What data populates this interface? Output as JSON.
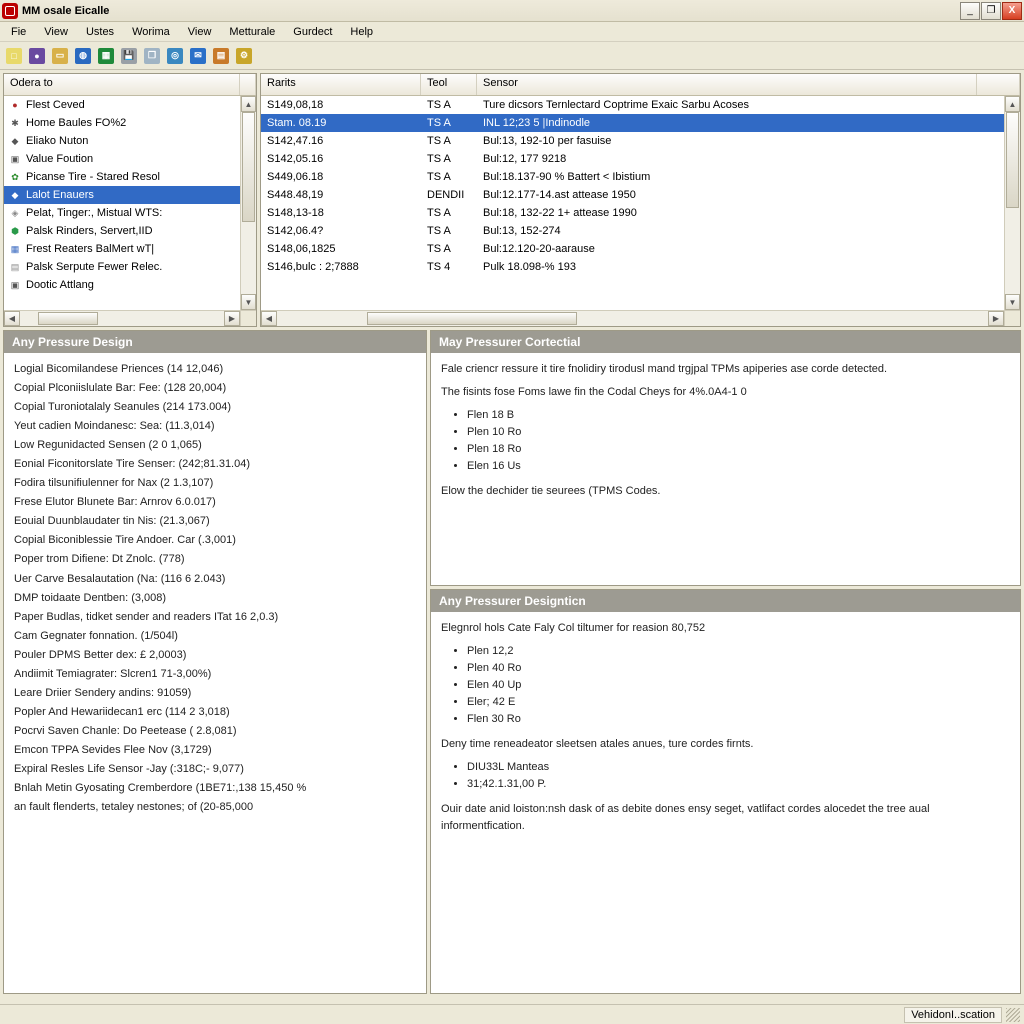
{
  "title": "MM osale Eicalle",
  "window_buttons": {
    "min": "_",
    "max": "❐",
    "close": "X"
  },
  "menu": [
    "Fie",
    "View",
    "Ustes",
    "Worima",
    "View",
    "Metturale",
    "Gurdect",
    "Help"
  ],
  "toolbar_icons": [
    {
      "name": "new-icon",
      "bg": "#e8d96a",
      "glyph": "□"
    },
    {
      "name": "globe-icon",
      "bg": "#6a4aa0",
      "glyph": "●"
    },
    {
      "name": "open-icon",
      "bg": "#d8b14a",
      "glyph": "▭"
    },
    {
      "name": "world-icon",
      "bg": "#2a6ac0",
      "glyph": "◍"
    },
    {
      "name": "sheet-icon",
      "bg": "#1f8a3a",
      "glyph": "▦"
    },
    {
      "name": "save-icon",
      "bg": "#9aa0a6",
      "glyph": "💾"
    },
    {
      "name": "copy-icon",
      "bg": "#a0b4c4",
      "glyph": "❐"
    },
    {
      "name": "sensor-icon",
      "bg": "#3a88c0",
      "glyph": "◎"
    },
    {
      "name": "chat-icon",
      "bg": "#2a70c8",
      "glyph": "✉"
    },
    {
      "name": "report-icon",
      "bg": "#c87a2a",
      "glyph": "▤"
    },
    {
      "name": "settings-icon",
      "bg": "#c8a62a",
      "glyph": "⚙"
    }
  ],
  "tree_header": "Odera to",
  "tree_items": [
    {
      "icon": "●",
      "color": "#b02a2a",
      "label": "Flest Ceved"
    },
    {
      "icon": "✱",
      "color": "#555",
      "label": "Home Baules FO%2"
    },
    {
      "icon": "◆",
      "color": "#555",
      "label": "Eliako Nuton"
    },
    {
      "icon": "▣",
      "color": "#555",
      "label": "Value Foution"
    },
    {
      "icon": "✿",
      "color": "#2a8a2a",
      "label": "Picanse Tire - Stared Resol"
    },
    {
      "icon": "◆",
      "color": "#2aa82a",
      "label": "Lalot Enauers",
      "selected": true
    },
    {
      "icon": "◈",
      "color": "#888",
      "label": "Pelat, Tinger:, Mistual WTS:"
    },
    {
      "icon": "⬢",
      "color": "#2a9a4a",
      "label": "Palsk Rinders, Servert,IID"
    },
    {
      "icon": "▦",
      "color": "#3a6ac0",
      "label": "Frest Reaters BalMert wT|"
    },
    {
      "icon": "▤",
      "color": "#888",
      "label": "Palsk Serpute Fewer Relec."
    },
    {
      "icon": "▣",
      "color": "#555",
      "label": "Dootic Attlang"
    }
  ],
  "table": {
    "cols": [
      "Rarits",
      "Teol",
      "Sensor"
    ],
    "widths": [
      160,
      56,
      500
    ],
    "rows": [
      {
        "c": [
          "S149,08,18",
          "TS A",
          "Ture dicsors Ternlectard Coptrime Exaic Sarbu Acoses"
        ]
      },
      {
        "c": [
          "Stam. 08.19",
          "TS A",
          "INL 12;23 5 |Indinodle"
        ],
        "selected": true
      },
      {
        "c": [
          "S142,47.16",
          "TS A",
          "Bul:13, 192-10 per fasuise"
        ]
      },
      {
        "c": [
          "S142,05.16",
          "TS A",
          "Bul:12, 177 9218"
        ]
      },
      {
        "c": [
          "S449,06.18",
          "TS A",
          "Bul:18.137-90 % Battert < Ibistium"
        ]
      },
      {
        "c": [
          "S448.48,19",
          "DENDII",
          "Bul:12.177-14.ast attease 1950"
        ]
      },
      {
        "c": [
          "S148,13-18",
          "TS A",
          "Bul:18, 132-22 1+ attease 1990"
        ]
      },
      {
        "c": [
          "S142,06.4?",
          "TS A",
          "Bul:13, 152-274"
        ]
      },
      {
        "c": [
          "S148,06,1825",
          "TS A",
          "Bul:12.120-20-aarause"
        ]
      },
      {
        "c": [
          "S146,bulc : 2;7888",
          "TS 4",
          "Pulk 18.098-% 193"
        ]
      }
    ]
  },
  "panel_left": {
    "title": "Any Pressure Design",
    "lines": [
      "Logial Bicomilandese Priences  (14 12,046)",
      "Copial Plconiislulate Bar: Fee: (128 20,004)",
      "Copial Turoniotalaly Seanules  (214 173.004)",
      "Yeut cadien Moindanesc: Sea:  (11.3,014)",
      "Low Regunidacted Sensen (2 0 1,065)",
      "Eonial Ficonitorslate Tire Senser: (242;81.31.04)",
      "Fodira tilsunifiulenner for Nax (2 1.3,107)",
      "Frese Elutor Blunete Bar: Arnrov 6.0.017)",
      "Eouial Duunblaudater tin Nis:  (21.3,067)",
      "Copial Biconiblessie Tire Andoer. Car  (.3,001)",
      "Poper trom Difiene:  Dt Znolc. (778)",
      "Uer Carve Besalautation (Na:  (116 6 2.043)",
      "DMP  toidaate Dentben:  (3,008)",
      "Paper Budlas, tidket sender and readers ITat 16 2,0.3)",
      "Cam Gegnater fonnation. (1/504l)",
      "Pouler DPMS Better dex: £ 2,0003)",
      "Andiimit Temiagrater: Slcren1 71-3,00%)",
      "Leare Driier Sendery andins:  91059)",
      "Popler And Hewariidecan1 erc (114 2 3,018)",
      "Pocrvi Saven Chanle:  Do Peetease ( 2.8,081)",
      "Emcon TPPA Sevides  Flee Nov (3,1729)",
      "Expiral Resles  Life Sensor -Jay (:318C;- 9,077)",
      "Bnlah Metin Gyosating Cremberdore  (1BE71:,138 15,450 %",
      "an fault flenderts, tetaley nestones; of (20-85,000"
    ]
  },
  "panel_top_right": {
    "title": "May Pressurer Cortectial",
    "para1": "Fale criencr ressure it tire fnolidiry tirodusl mand trgjpal TPMs apiperies ase corde detected.",
    "para2": "The fisints fose Foms lawe fin the Codal Cheys for 4%.0A4-1 0",
    "bullets": [
      "Flen 18 B",
      "Plen 10 Ro",
      "Plen 18 Ro",
      "Elen 16 Us"
    ],
    "para3": "Elow the dechider tie seurees (TPMS Codes."
  },
  "panel_bot_right": {
    "title": "Any Pressurer Designticn",
    "para1": "Elegnrol hols Cate Faly Col tiltumer for reasion 80,752",
    "bullets1": [
      "Plen 12,2",
      "Plen 40 Ro",
      "Elen 40 Up",
      "Eler; 42 E",
      "Flen 30 Ro"
    ],
    "para2": "Deny time reneadeator sleetsen atales anues, ture cordes firnts.",
    "bullets2": [
      "DIU33L Manteas",
      "31;42.1.31,00 P."
    ],
    "para3": "Ouir date anid loiston:nsh dask of as debite dones ensy seget, vatlifact cordes alocedet the tree aual informentfication."
  },
  "status": "VehidonI..scation"
}
